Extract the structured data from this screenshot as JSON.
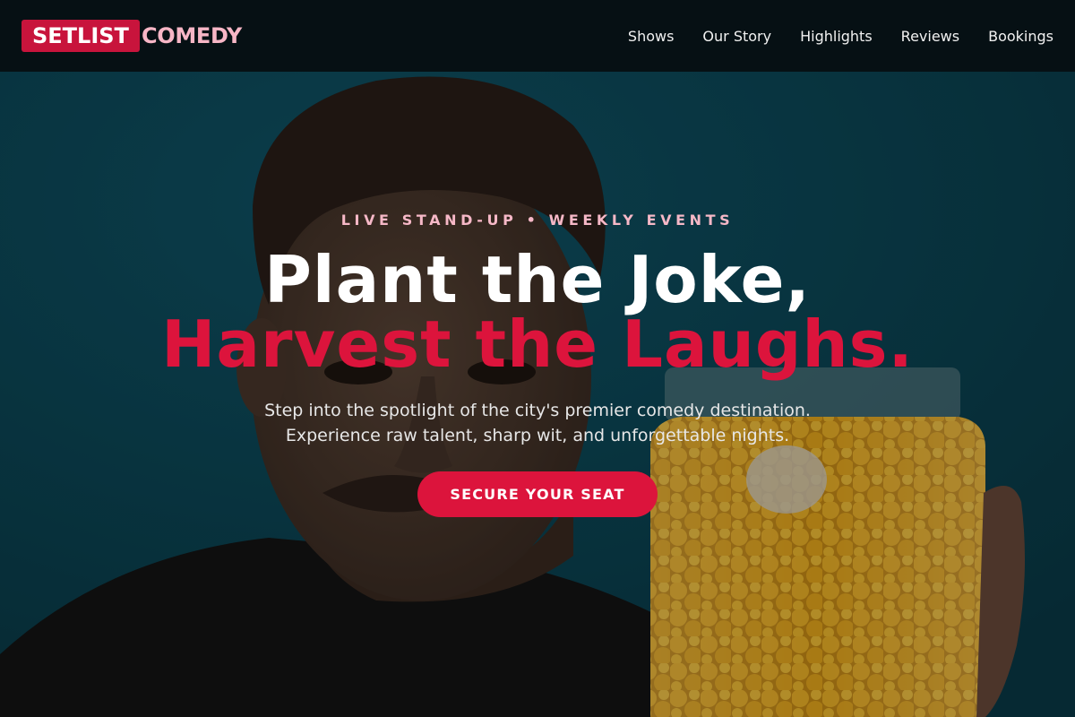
{
  "brand": {
    "logo_box_text": "SETLIST",
    "logo_word_text": "COMEDY",
    "accent_color": "#dc143c",
    "logo_word_color": "#f7b6c6"
  },
  "nav": {
    "items": [
      {
        "label": "Shows"
      },
      {
        "label": "Our Story"
      },
      {
        "label": "Highlights"
      },
      {
        "label": "Reviews"
      },
      {
        "label": "Bookings"
      }
    ]
  },
  "hero": {
    "eyebrow": "LIVE STAND-UP • WEEKLY EVENTS",
    "headline_line1": "Plant the Joke,",
    "headline_line2": "Harvest the Laughs.",
    "subtitle_line1": "Step into the spotlight of the city's premier comedy destination.",
    "subtitle_line2": "Experience raw talent, sharp wit, and unforgettable nights.",
    "cta_label": "SECURE YOUR SEAT",
    "background_image": "man-with-mustache-holding-jar-of-cheese-balls",
    "background_color": "#0c4656"
  }
}
